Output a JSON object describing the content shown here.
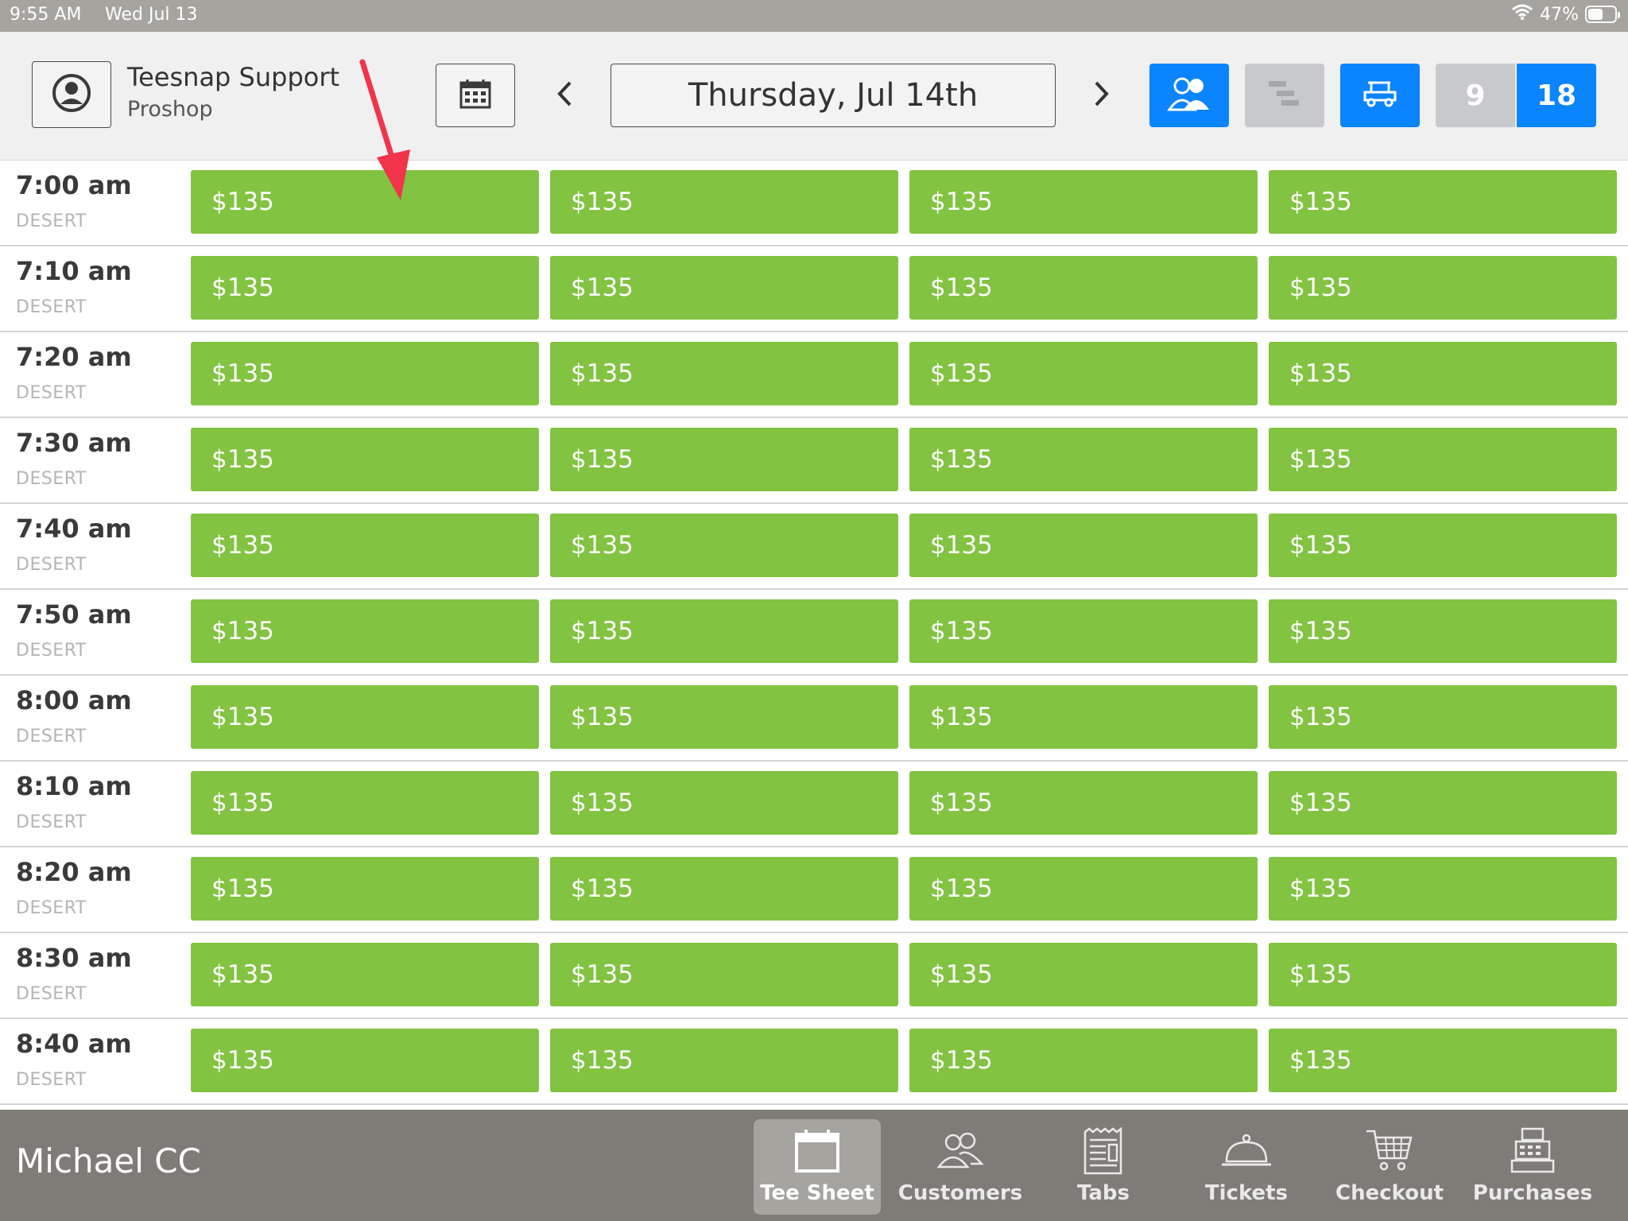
{
  "status_bar": {
    "time": "9:55 AM",
    "date": "Wed Jul 13",
    "battery": "47%"
  },
  "header": {
    "user_name": "Teesnap Support",
    "user_role": "Proshop",
    "date": "Thursday, Jul 14th",
    "holes_9": "9",
    "holes_18": "18",
    "accent_color": "#0a84ff"
  },
  "rows": [
    {
      "time": "7:00 am",
      "course": "DESERT",
      "slots": [
        "$135",
        "$135",
        "$135",
        "$135"
      ]
    },
    {
      "time": "7:10 am",
      "course": "DESERT",
      "slots": [
        "$135",
        "$135",
        "$135",
        "$135"
      ]
    },
    {
      "time": "7:20 am",
      "course": "DESERT",
      "slots": [
        "$135",
        "$135",
        "$135",
        "$135"
      ]
    },
    {
      "time": "7:30 am",
      "course": "DESERT",
      "slots": [
        "$135",
        "$135",
        "$135",
        "$135"
      ]
    },
    {
      "time": "7:40 am",
      "course": "DESERT",
      "slots": [
        "$135",
        "$135",
        "$135",
        "$135"
      ]
    },
    {
      "time": "7:50 am",
      "course": "DESERT",
      "slots": [
        "$135",
        "$135",
        "$135",
        "$135"
      ]
    },
    {
      "time": "8:00 am",
      "course": "DESERT",
      "slots": [
        "$135",
        "$135",
        "$135",
        "$135"
      ]
    },
    {
      "time": "8:10 am",
      "course": "DESERT",
      "slots": [
        "$135",
        "$135",
        "$135",
        "$135"
      ]
    },
    {
      "time": "8:20 am",
      "course": "DESERT",
      "slots": [
        "$135",
        "$135",
        "$135",
        "$135"
      ]
    },
    {
      "time": "8:30 am",
      "course": "DESERT",
      "slots": [
        "$135",
        "$135",
        "$135",
        "$135"
      ]
    },
    {
      "time": "8:40 am",
      "course": "DESERT",
      "slots": [
        "$135",
        "$135",
        "$135",
        "$135"
      ]
    }
  ],
  "slot_color": "#82c341",
  "bottom_bar": {
    "club_name": "Michael CC",
    "tabs": [
      {
        "label": "Tee Sheet",
        "icon": "calendar-icon",
        "active": true
      },
      {
        "label": "Customers",
        "icon": "customers-icon",
        "active": false
      },
      {
        "label": "Tabs",
        "icon": "tabs-icon",
        "active": false
      },
      {
        "label": "Tickets",
        "icon": "cloche-icon",
        "active": false
      },
      {
        "label": "Checkout",
        "icon": "cart-icon",
        "active": false
      },
      {
        "label": "Purchases",
        "icon": "register-icon",
        "active": false
      }
    ]
  }
}
